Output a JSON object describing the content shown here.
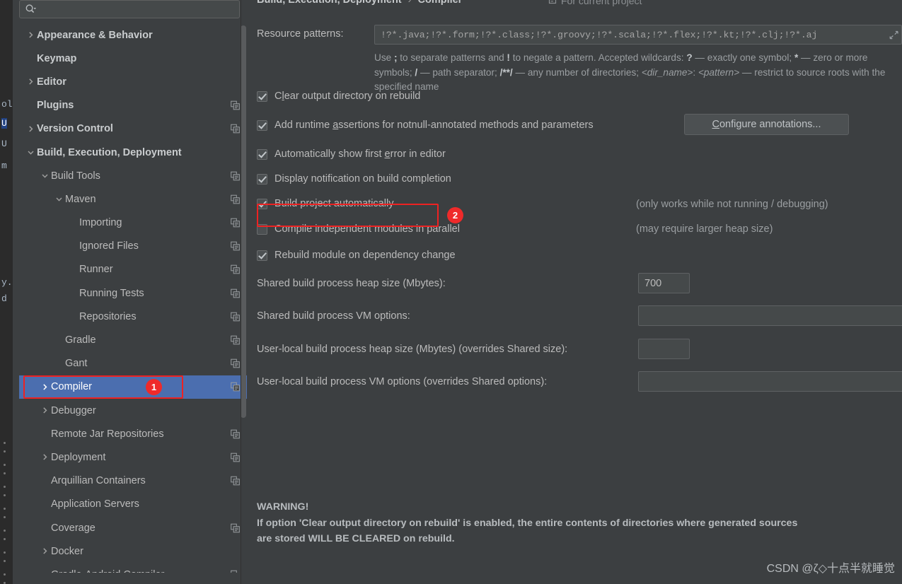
{
  "dialog": {
    "search": {
      "value": "",
      "placeholder": "",
      "icon": "search-icon"
    },
    "breadcrumb": {
      "root": "Build, Execution, Deployment",
      "separator": "›",
      "leaf": "Compiler",
      "scope_icon": "project-scope-icon",
      "scope_label": "For current project"
    }
  },
  "sidebar": {
    "items": [
      {
        "label": "Appearance & Behavior",
        "arrow": "right",
        "indent": 0,
        "bold": true,
        "copy": false,
        "selected": false
      },
      {
        "label": "Keymap",
        "arrow": "none",
        "indent": 0,
        "bold": true,
        "copy": false,
        "selected": false
      },
      {
        "label": "Editor",
        "arrow": "right",
        "indent": 0,
        "bold": true,
        "copy": false,
        "selected": false
      },
      {
        "label": "Plugins",
        "arrow": "none",
        "indent": 0,
        "bold": true,
        "copy": true,
        "selected": false
      },
      {
        "label": "Version Control",
        "arrow": "right",
        "indent": 0,
        "bold": true,
        "copy": true,
        "selected": false
      },
      {
        "label": "Build, Execution, Deployment",
        "arrow": "down",
        "indent": 0,
        "bold": true,
        "copy": false,
        "selected": false
      },
      {
        "label": "Build Tools",
        "arrow": "down",
        "indent": 1,
        "bold": false,
        "copy": true,
        "selected": false
      },
      {
        "label": "Maven",
        "arrow": "down",
        "indent": 2,
        "bold": false,
        "copy": true,
        "selected": false
      },
      {
        "label": "Importing",
        "arrow": "none",
        "indent": 3,
        "bold": false,
        "copy": true,
        "selected": false
      },
      {
        "label": "Ignored Files",
        "arrow": "none",
        "indent": 3,
        "bold": false,
        "copy": true,
        "selected": false
      },
      {
        "label": "Runner",
        "arrow": "none",
        "indent": 3,
        "bold": false,
        "copy": true,
        "selected": false
      },
      {
        "label": "Running Tests",
        "arrow": "none",
        "indent": 3,
        "bold": false,
        "copy": true,
        "selected": false
      },
      {
        "label": "Repositories",
        "arrow": "none",
        "indent": 3,
        "bold": false,
        "copy": true,
        "selected": false
      },
      {
        "label": "Gradle",
        "arrow": "none",
        "indent": 2,
        "bold": false,
        "copy": true,
        "selected": false
      },
      {
        "label": "Gant",
        "arrow": "none",
        "indent": 2,
        "bold": false,
        "copy": true,
        "selected": false
      },
      {
        "label": "Compiler",
        "arrow": "right",
        "indent": 1,
        "bold": false,
        "copy": true,
        "selected": true
      },
      {
        "label": "Debugger",
        "arrow": "right",
        "indent": 1,
        "bold": false,
        "copy": false,
        "selected": false
      },
      {
        "label": "Remote Jar Repositories",
        "arrow": "none",
        "indent": 1,
        "bold": false,
        "copy": true,
        "selected": false
      },
      {
        "label": "Deployment",
        "arrow": "right",
        "indent": 1,
        "bold": false,
        "copy": true,
        "selected": false
      },
      {
        "label": "Arquillian Containers",
        "arrow": "none",
        "indent": 1,
        "bold": false,
        "copy": true,
        "selected": false
      },
      {
        "label": "Application Servers",
        "arrow": "none",
        "indent": 1,
        "bold": false,
        "copy": false,
        "selected": false
      },
      {
        "label": "Coverage",
        "arrow": "none",
        "indent": 1,
        "bold": false,
        "copy": true,
        "selected": false
      },
      {
        "label": "Docker",
        "arrow": "right",
        "indent": 1,
        "bold": false,
        "copy": false,
        "selected": false
      },
      {
        "label": "Gradle-Android Compiler",
        "arrow": "none",
        "indent": 1,
        "bold": false,
        "copy": true,
        "selected": false
      }
    ]
  },
  "compiler": {
    "resource_patterns": {
      "label": "Resource patterns:",
      "value": "!?*.java;!?*.form;!?*.class;!?*.groovy;!?*.scala;!?*.flex;!?*.kt;!?*.clj;!?*.aj",
      "expand_icon": "expand-field-icon",
      "help_part1": "Use ",
      "help_b1": ";",
      "help_part2": " to separate patterns and ",
      "help_b2": "!",
      "help_part3": " to negate a pattern. Accepted wildcards: ",
      "help_b3": "?",
      "help_part4": " — exactly one symbol; ",
      "help_b4": "*",
      "help_part5": " — zero or more symbols; ",
      "help_b5": "/",
      "help_part6": " — path separator; ",
      "help_b6": "/**/",
      "help_part7": " — any number of directories; ",
      "help_i1": "<dir_name>",
      "help_part8": ": ",
      "help_i2": "<pattern>",
      "help_part9": " — restrict to source roots with the specified name"
    },
    "checkboxes": [
      {
        "label_pre": "C",
        "mnemonic": "l",
        "label_post": "ear output directory on rebuild",
        "checked": true
      },
      {
        "label_pre": "Add runtime ",
        "mnemonic": "a",
        "label_post": "ssertions for notnull-annotated methods and parameters",
        "checked": true
      },
      {
        "label_pre": "Automatically show first ",
        "mnemonic": "e",
        "label_post": "rror in editor",
        "checked": true
      },
      {
        "label_pre": "Display notification on build completion",
        "mnemonic": "",
        "label_post": "",
        "checked": true
      },
      {
        "label_pre": "Build project automatically",
        "mnemonic": "",
        "label_post": "",
        "checked": true
      },
      {
        "label_pre": "Compile independent modules in parallel",
        "mnemonic": "",
        "label_post": "",
        "checked": false
      },
      {
        "label_pre": "Rebuild module on dependency change",
        "mnemonic": "",
        "label_post": "",
        "checked": true
      }
    ],
    "configure_annotations": {
      "pre": "",
      "mnemonic": "C",
      "post": "onfigure annotations..."
    },
    "hint_auto_build": "(only works while not running / debugging)",
    "hint_parallel": "(may require larger heap size)",
    "fields": [
      {
        "label": "Shared build process heap size (Mbytes):",
        "value": "700",
        "wide": false
      },
      {
        "label": "Shared build process VM options:",
        "value": "",
        "wide": true
      },
      {
        "label": "User-local build process heap size (Mbytes) (overrides Shared size):",
        "value": "",
        "wide": false
      },
      {
        "label": "User-local build process VM options (overrides Shared options):",
        "value": "",
        "wide": true
      }
    ],
    "warning": {
      "title": "WARNING!",
      "line1": "If option 'Clear output directory on rebuild' is enabled, the entire contents of directories where generated sources",
      "line2": "are stored WILL BE CLEARED on rebuild."
    }
  },
  "annotations": {
    "badge_1": "1",
    "badge_2": "2",
    "color": "#ee2222"
  },
  "editor_background": {
    "fragments": [
      "ol",
      "U",
      "U",
      "m",
      "y.)",
      "d"
    ]
  },
  "watermark": "CSDN @ζ◇十点半就睡觉"
}
